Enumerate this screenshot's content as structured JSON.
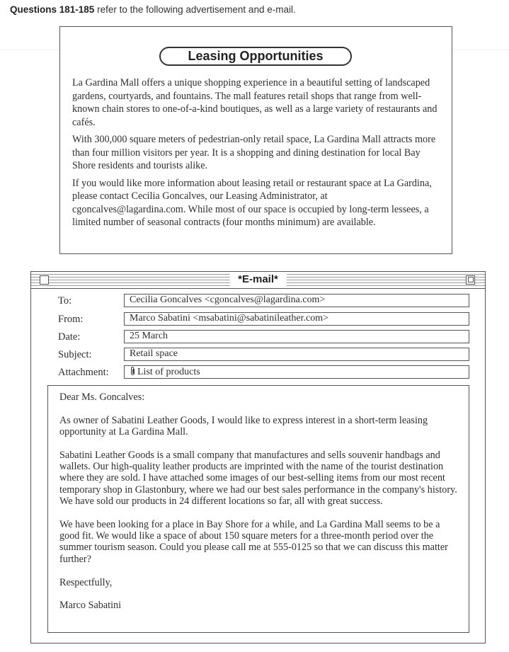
{
  "header": {
    "range": "Questions 181-185",
    "text": "refer to the following advertisement and e-mail."
  },
  "ad": {
    "title": "Leasing Opportunities",
    "paragraphs": [
      "La Gardina Mall offers a unique shopping experience in a beautiful setting of landscaped gardens, courtyards, and fountains. The mall features retail shops that range from well-known chain stores to one-of-a-kind boutiques, as well as a large variety of restaurants and cafés.",
      "With 300,000 square meters of pedestrian-only retail space, La Gardina Mall attracts more than four million visitors per year. It is a shopping and dining destination for local Bay Shore residents and tourists alike.",
      "If you would like more information about leasing retail or restaurant space at La Gardina, please contact Cecilia Goncalves, our Leasing Administrator, at cgoncalves@lagardina.com. While most of our space is occupied by long-term lessees, a limited number of seasonal contracts (four months minimum) are available."
    ]
  },
  "email": {
    "window_title": "*E-mail*",
    "fields": {
      "to_label": "To:",
      "to_value": "Cecilia Goncalves <cgoncalves@lagardina.com>",
      "from_label": "From:",
      "from_value": "Marco Sabatini <msabatini@sabatinileather.com>",
      "date_label": "Date:",
      "date_value": "25 March",
      "subject_label": "Subject:",
      "subject_value": "Retail space",
      "attachment_label": "Attachment:",
      "attachment_value": "List of products"
    },
    "body": {
      "greeting": "Dear Ms. Goncalves:",
      "paragraphs": [
        "As owner of Sabatini Leather Goods, I would like to express interest in a short-term leasing opportunity at La Gardina Mall.",
        "Sabatini Leather Goods is a small company that manufactures and sells souvenir handbags and wallets. Our high-quality leather products are imprinted with the name of the tourist destination where they are sold. I have attached some images of our best-selling items from our most recent temporary shop in Glastonbury, where we had our best sales performance in the company's history. We have sold our products in 24 different locations so far, all with great success.",
        "We have been looking for a place in Bay Shore for a while, and La Gardina Mall seems to be a good fit. We would like a space of about 150 square meters for a three-month period over the summer tourism season. Could you please call me at 555-0125 so that we can discuss this matter further?"
      ],
      "closing": "Respectfully,",
      "signature": "Marco Sabatini"
    }
  }
}
